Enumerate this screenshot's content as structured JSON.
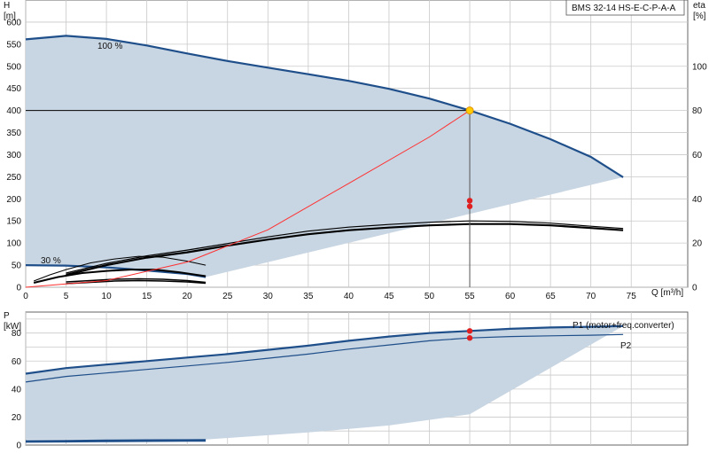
{
  "chart_data": [
    {
      "type": "line",
      "panel": "head",
      "pump_label": "BMS 32-14 HS-E-C-P-A-A",
      "ylabel": "H",
      "yunit": "[m]",
      "xlabel": "Q [m³/h]",
      "y2label": "eta",
      "y2unit": "[%]",
      "xlim": [
        0,
        82
      ],
      "ylim": [
        0,
        650
      ],
      "y2lim": [
        0,
        130
      ],
      "xticks": [
        "0",
        "5",
        "10",
        "15",
        "20",
        "25",
        "30",
        "35",
        "40",
        "45",
        "50",
        "55",
        "60",
        "65",
        "70",
        "75"
      ],
      "yticks": [
        "0",
        "50",
        "100",
        "150",
        "200",
        "250",
        "300",
        "350",
        "400",
        "450",
        "500",
        "550",
        "600"
      ],
      "y2ticks": [
        "0",
        "20",
        "40",
        "60",
        "80",
        "100"
      ],
      "grid": true,
      "operating_point": {
        "x": 55,
        "y": 400
      },
      "series": [
        {
          "name": "100 %",
          "x": [
            0,
            5,
            10,
            15,
            20,
            25,
            30,
            35,
            40,
            45,
            50,
            55,
            60,
            65,
            70,
            74
          ],
          "y": [
            561,
            569,
            562,
            547,
            529,
            512,
            497,
            482,
            467,
            449,
            427,
            400,
            370,
            335,
            295,
            249
          ]
        },
        {
          "name": "30 %",
          "x": [
            0,
            5,
            10,
            15,
            20,
            22.3
          ],
          "y": [
            50,
            49,
            45,
            38,
            30,
            23
          ]
        },
        {
          "x": [
            0,
            10,
            20,
            30,
            40,
            50,
            55,
            60,
            65,
            70,
            74
          ],
          "y": [
            0,
            10,
            30,
            60,
            100,
            150,
            180,
            210,
            240,
            270,
            290
          ]
        },
        {
          "x": [
            0,
            10,
            20,
            30,
            40,
            50,
            55,
            60,
            65,
            70,
            74
          ],
          "y": [
            0,
            5,
            20,
            45,
            75,
            110,
            130,
            150,
            170,
            190,
            200
          ]
        },
        {
          "x": [
            5,
            10,
            15,
            20,
            25,
            30,
            35,
            40,
            45,
            50,
            55,
            60,
            65,
            70,
            74
          ],
          "y": [
            32,
            54,
            71,
            84,
            99,
            114,
            127,
            136,
            142,
            147,
            150,
            149,
            145,
            138,
            133
          ]
        },
        {
          "x": [
            5,
            10,
            15,
            20,
            25,
            30,
            35,
            40,
            45,
            50,
            55,
            60,
            65,
            70,
            74
          ],
          "y": [
            28,
            50,
            67,
            79,
            94,
            108,
            120,
            129,
            135,
            140,
            143,
            143,
            140,
            134,
            129
          ]
        },
        {
          "x": [
            1,
            3,
            5,
            8,
            11,
            14,
            17,
            20,
            22.3
          ],
          "y": [
            14,
            28,
            40,
            55,
            64,
            70,
            68,
            59,
            50
          ]
        },
        {
          "x": [
            1,
            4,
            7,
            10,
            13,
            16,
            19,
            22.3
          ],
          "y": [
            10,
            23,
            32,
            37,
            40,
            40,
            34,
            25
          ]
        },
        {
          "x": [
            5,
            8,
            11,
            14,
            17,
            20,
            22.3
          ],
          "y": [
            12,
            15,
            18,
            19,
            18,
            15,
            11
          ]
        },
        {
          "x": [
            5,
            8,
            11,
            14,
            17,
            20,
            22.3
          ],
          "y": [
            8,
            11,
            14,
            15,
            14,
            12,
            9
          ]
        },
        {
          "x": [
            0,
            10,
            20,
            30,
            40,
            50,
            55
          ],
          "y": [
            0,
            15,
            57,
            130,
            235,
            340,
            400
          ]
        }
      ],
      "annotations": [
        "100 %",
        "30 %"
      ]
    },
    {
      "type": "line",
      "panel": "power",
      "ylabel": "P",
      "yunit": "[kW]",
      "ylim": [
        0,
        95
      ],
      "yticks": [
        "0",
        "20",
        "40",
        "60",
        "80"
      ],
      "grid": true,
      "operating_point": {
        "x": 55,
        "p1": 81.5,
        "p2": 76.5
      },
      "series": [
        {
          "name": "P1 (motor+freq.converter)",
          "x": [
            0,
            5,
            10,
            15,
            20,
            25,
            30,
            35,
            40,
            45,
            50,
            55,
            60,
            65,
            70,
            74
          ],
          "y": [
            51,
            55,
            57.5,
            60,
            62.5,
            65,
            68,
            71,
            74.5,
            77.5,
            80,
            81.5,
            83,
            84,
            84.5,
            85
          ]
        },
        {
          "name": "P2",
          "x": [
            0,
            5,
            10,
            15,
            20,
            25,
            30,
            35,
            40,
            45,
            50,
            55,
            60,
            65,
            70,
            74
          ],
          "y": [
            45,
            49,
            51.5,
            54,
            56.5,
            59,
            62,
            65,
            68.5,
            71.5,
            74.5,
            76.5,
            77.5,
            78,
            78.5,
            79
          ]
        },
        {
          "x": [
            0,
            5,
            10,
            15,
            20,
            22.3
          ],
          "y": [
            2.8,
            3.0,
            3.2,
            3.4,
            3.5,
            3.6
          ]
        },
        {
          "x": [
            0,
            5,
            10,
            15,
            20,
            22.3
          ],
          "y": [
            2.0,
            2.2,
            2.4,
            2.6,
            2.7,
            2.8
          ]
        }
      ]
    }
  ],
  "theme": {
    "band": "#c8d5e2",
    "curve": "#1f4f8a",
    "axis": "#555555",
    "point": "#e02020",
    "op_point": "#ffcc00"
  }
}
